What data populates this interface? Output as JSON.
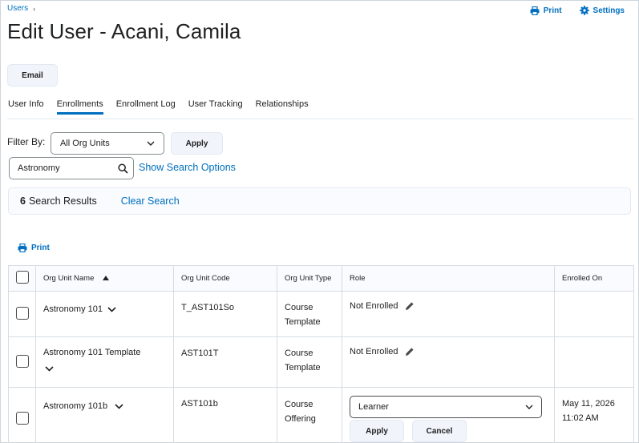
{
  "breadcrumb": {
    "parent": "Users",
    "separator": "›"
  },
  "header": {
    "title": "Edit User - Acani, Camila",
    "print_label": "Print",
    "settings_label": "Settings"
  },
  "email_button": "Email",
  "tabs": [
    {
      "label": "User Info",
      "active": false
    },
    {
      "label": "Enrollments",
      "active": true
    },
    {
      "label": "Enrollment Log",
      "active": false
    },
    {
      "label": "User Tracking",
      "active": false
    },
    {
      "label": "Relationships",
      "active": false
    }
  ],
  "filter": {
    "label": "Filter By:",
    "selected": "All Org Units",
    "apply_label": "Apply"
  },
  "search": {
    "value": "Astronomy",
    "show_options_label": "Show Search Options"
  },
  "results": {
    "count": "6",
    "label": "Search Results",
    "clear_label": "Clear Search"
  },
  "table_print_label": "Print",
  "table": {
    "headers": [
      "Org Unit Name",
      "Org Unit Code",
      "Org Unit Type",
      "Role",
      "Enrolled On"
    ],
    "rows": [
      {
        "name": "Astronomy 101",
        "code": "T_AST101So",
        "type_line1": "Course",
        "type_line2": "Template",
        "role": "Not Enrolled",
        "enrolled_date": "",
        "enrolled_time": ""
      },
      {
        "name": "Astronomy 101 Template",
        "code": "AST101T",
        "type_line1": "Course",
        "type_line2": "Template",
        "role": "Not Enrolled",
        "enrolled_date": "",
        "enrolled_time": ""
      },
      {
        "name": "Astronomy 101b",
        "code": "AST101b",
        "type_line1": "Course",
        "type_line2": "Offering",
        "role": "Learner",
        "enrolled_date": "May 11, 2026",
        "enrolled_time": "11:02 AM",
        "apply_label": "Apply",
        "cancel_label": "Cancel"
      }
    ]
  },
  "colors": {
    "accent": "#006fbf",
    "button_bg": "#f1f5fb",
    "header_bg": "#f9fbff",
    "border": "#d6dce2"
  }
}
